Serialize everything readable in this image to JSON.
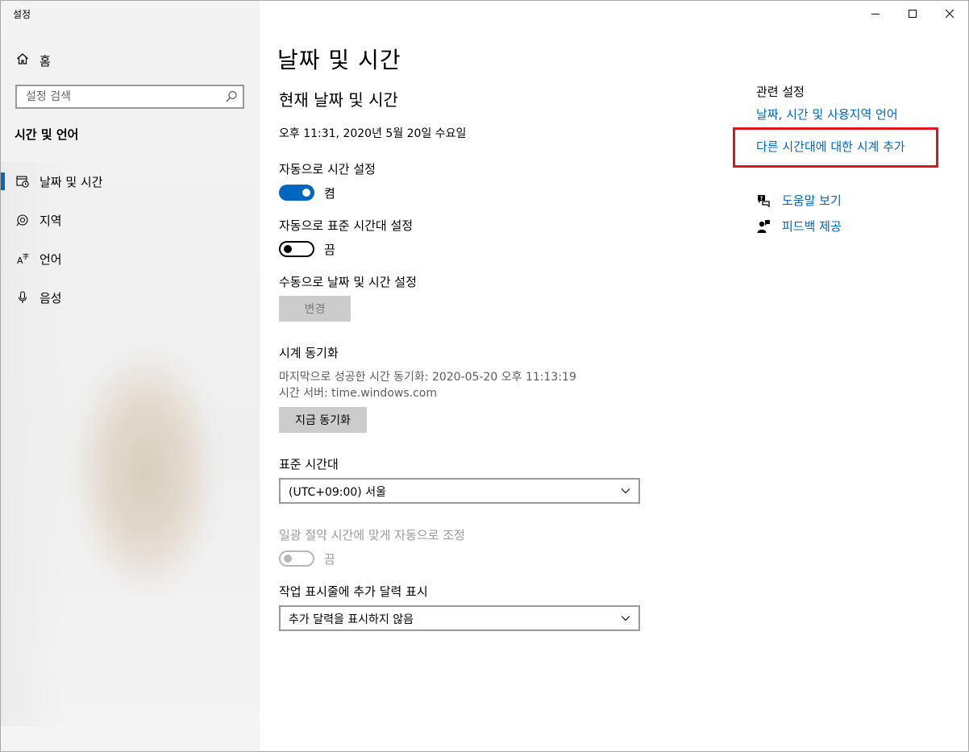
{
  "app": {
    "title": "설정"
  },
  "sidebar": {
    "home_label": "홈",
    "search_placeholder": "설정 검색",
    "section_title": "시간 및 언어",
    "items": [
      {
        "label": "날짜 및 시간",
        "icon": "date-time-icon",
        "active": true
      },
      {
        "label": "지역",
        "icon": "region-icon",
        "active": false
      },
      {
        "label": "언어",
        "icon": "language-icon",
        "active": false
      },
      {
        "label": "음성",
        "icon": "microphone-icon",
        "active": false
      }
    ]
  },
  "main": {
    "page_title": "날짜 및 시간",
    "section_title": "현재 날짜 및 시간",
    "current_datetime": "오후 11:31, 2020년 5월 20일 수요일",
    "auto_time": {
      "label": "자동으로 시간 설정",
      "state": "켬",
      "on": true
    },
    "auto_timezone": {
      "label": "자동으로 표준 시간대 설정",
      "state": "끔",
      "on": false
    },
    "manual": {
      "label": "수동으로 날짜 및 시간 설정",
      "button": "변경"
    },
    "sync": {
      "title": "시계 동기화",
      "last_sync": "마지막으로 성공한 시간 동기화: 2020-05-20 오후 11:13:19",
      "server": "시간 서버: time.windows.com",
      "button": "지금 동기화"
    },
    "timezone": {
      "label": "표준 시간대",
      "value": "(UTC+09:00) 서울"
    },
    "dst": {
      "label": "일광 절약 시간에 맞게 자동으로 조정",
      "state": "끔",
      "enabled": false
    },
    "calendar": {
      "label": "작업 표시줄에 추가 달력 표시",
      "value": "추가 달력을 표시하지 않음"
    }
  },
  "related": {
    "title": "관련 설정",
    "link1": "날짜, 시간 및 사용지역 언어",
    "link2": "다른 시간대에 대한 시계 추가",
    "help": "도움말 보기",
    "feedback": "피드백 제공"
  },
  "colors": {
    "accent": "#0067c0",
    "highlight_box": "#e0141e"
  }
}
